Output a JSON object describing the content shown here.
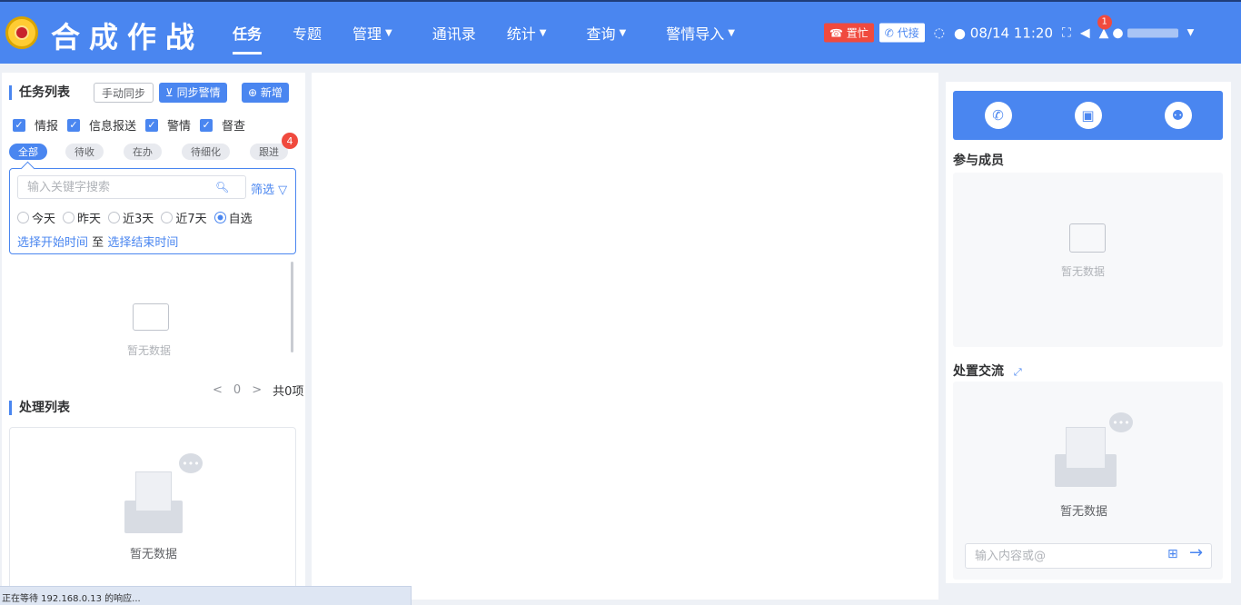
{
  "app": {
    "title": "合成作战"
  },
  "nav": [
    {
      "label": "任务",
      "dropdown": false,
      "active": true
    },
    {
      "label": "专题",
      "dropdown": false
    },
    {
      "label": "管理",
      "dropdown": true
    },
    {
      "label": "通讯录",
      "dropdown": false
    },
    {
      "label": "统计",
      "dropdown": true
    },
    {
      "label": "查询",
      "dropdown": true
    },
    {
      "label": "警情导入",
      "dropdown": true
    }
  ],
  "topbar": {
    "busy_label": "置忙",
    "proxy_label": "代接",
    "datetime": "08/14 11:20",
    "notification_count": "1"
  },
  "task_list": {
    "title": "任务列表",
    "manual_sync": "手动同步",
    "sync_alerts": "同步警情",
    "add": "新增",
    "checkboxes": [
      "情报",
      "信息报送",
      "警情",
      "督查"
    ],
    "tabs": [
      "全部",
      "待收",
      "在办",
      "待细化",
      "跟进"
    ],
    "follow_badge": "4",
    "search_placeholder": "输入关键字搜索",
    "filter": "筛选",
    "date_options": [
      "今天",
      "昨天",
      "近3天",
      "近7天",
      "自选"
    ],
    "selected_date_option": "自选",
    "start_time": "选择开始时间",
    "to": "至",
    "end_time": "选择结束时间",
    "empty": "暂无数据",
    "page": "0",
    "total": "共0项"
  },
  "process_list": {
    "title": "处理列表",
    "empty": "暂无数据"
  },
  "right_panel": {
    "members_title": "参与成员",
    "members_empty": "暂无数据",
    "chat_title": "处置交流",
    "chat_empty": "暂无数据",
    "chat_placeholder": "输入内容或@"
  },
  "statusbar": {
    "text": "正在等待 192.168.0.13 的响应..."
  },
  "colors": {
    "primary": "#4a86f0",
    "danger": "#f04a3e"
  }
}
